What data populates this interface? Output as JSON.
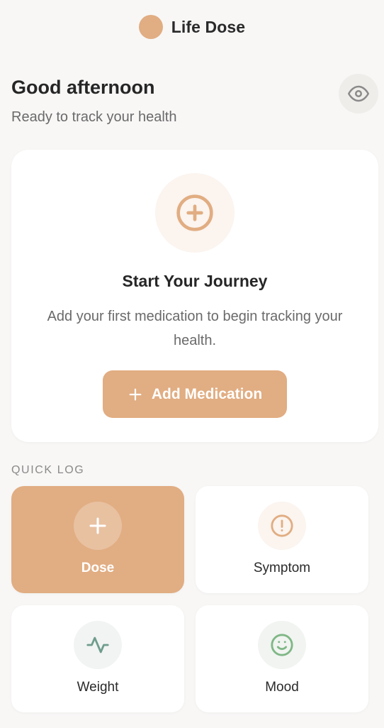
{
  "header": {
    "title": "Life Dose",
    "logo_color": "#e1ad82"
  },
  "greeting": {
    "title": "Good afternoon",
    "subtitle": "Ready to track your health",
    "privacy_icon": "eye-icon"
  },
  "journey": {
    "icon": "plus-circle-icon",
    "title": "Start Your Journey",
    "text": "Add your first medication to begin tracking your health.",
    "button_label": "Add Medication",
    "button_icon": "plus-icon"
  },
  "quick_log": {
    "section_label": "QUICK LOG",
    "items": [
      {
        "label": "Dose",
        "icon": "plus-icon",
        "active": true
      },
      {
        "label": "Symptom",
        "icon": "alert-circle-icon",
        "active": false
      },
      {
        "label": "Weight",
        "icon": "activity-icon",
        "active": false
      },
      {
        "label": "Mood",
        "icon": "smile-icon",
        "active": false
      }
    ]
  },
  "colors": {
    "accent": "#e1ad82",
    "background": "#f8f7f6",
    "weight_icon": "#6f9c8d",
    "mood_icon": "#7fb785"
  }
}
